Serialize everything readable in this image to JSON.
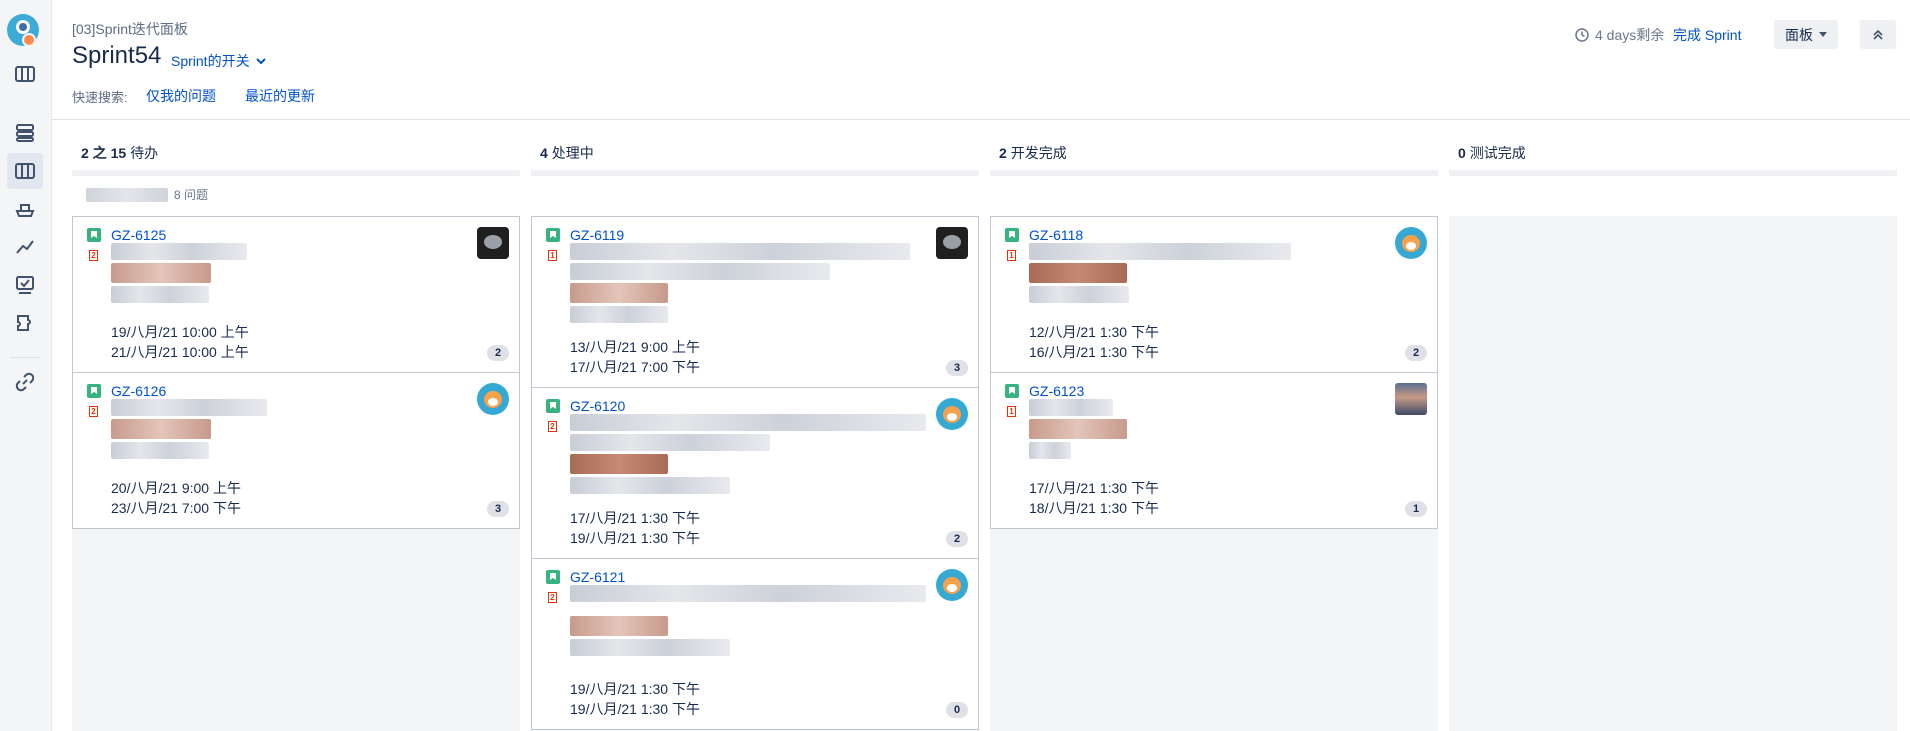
{
  "sidebar": {
    "items": [
      {
        "icon": "roadmap-icon"
      },
      {
        "icon": "backlog-icon"
      },
      {
        "icon": "board-icon"
      },
      {
        "icon": "releases-icon"
      },
      {
        "icon": "reports-icon"
      },
      {
        "icon": "issues-icon"
      },
      {
        "icon": "components-icon"
      },
      {
        "icon": "link-icon"
      }
    ]
  },
  "header": {
    "breadcrumb": "[03]Sprint迭代面板",
    "sprint_title": "Sprint54",
    "sprint_toggle": "Sprint的开关",
    "quick_search_label": "快速搜索:",
    "quick_filters": [
      "仅我的问题",
      "最近的更新"
    ],
    "days_left": "4 days剩余",
    "complete_sprint": "完成 Sprint",
    "board_button": "面板"
  },
  "columns": [
    {
      "count": "2 之 15",
      "name": "待办"
    },
    {
      "count": "4",
      "name": "处理中"
    },
    {
      "count": "2",
      "name": "开发完成"
    },
    {
      "count": "0",
      "name": "测试完成"
    }
  ],
  "swimlane": {
    "issues": "8 问题"
  },
  "cards": {
    "c6125": {
      "key": "GZ-6125",
      "priority": "2",
      "start": "19/八月/21 10:00 上午",
      "end": "21/八月/21 10:00 上午",
      "count": "2"
    },
    "c6126": {
      "key": "GZ-6126",
      "priority": "2",
      "start": "20/八月/21 9:00 上午",
      "end": "23/八月/21 7:00 下午",
      "count": "3"
    },
    "c6119": {
      "key": "GZ-6119",
      "priority": "1",
      "start": "13/八月/21 9:00 上午",
      "end": "17/八月/21 7:00 下午",
      "count": "3"
    },
    "c6120": {
      "key": "GZ-6120",
      "priority": "2",
      "start": "17/八月/21 1:30 下午",
      "end": "19/八月/21 1:30 下午",
      "count": "2"
    },
    "c6121": {
      "key": "GZ-6121",
      "priority": "2",
      "start": "19/八月/21 1:30 下午",
      "end": "19/八月/21 1:30 下午",
      "count": "0"
    },
    "c6118": {
      "key": "GZ-6118",
      "priority": "1",
      "start": "12/八月/21 1:30 下午",
      "end": "16/八月/21 1:30 下午",
      "count": "2"
    },
    "c6123": {
      "key": "GZ-6123",
      "priority": "1",
      "start": "17/八月/21 1:30 下午",
      "end": "18/八月/21 1:30 下午",
      "count": "1"
    }
  },
  "colors": {
    "accent": "#0052cc",
    "story": "#36b37e",
    "priority": "#de350b"
  }
}
